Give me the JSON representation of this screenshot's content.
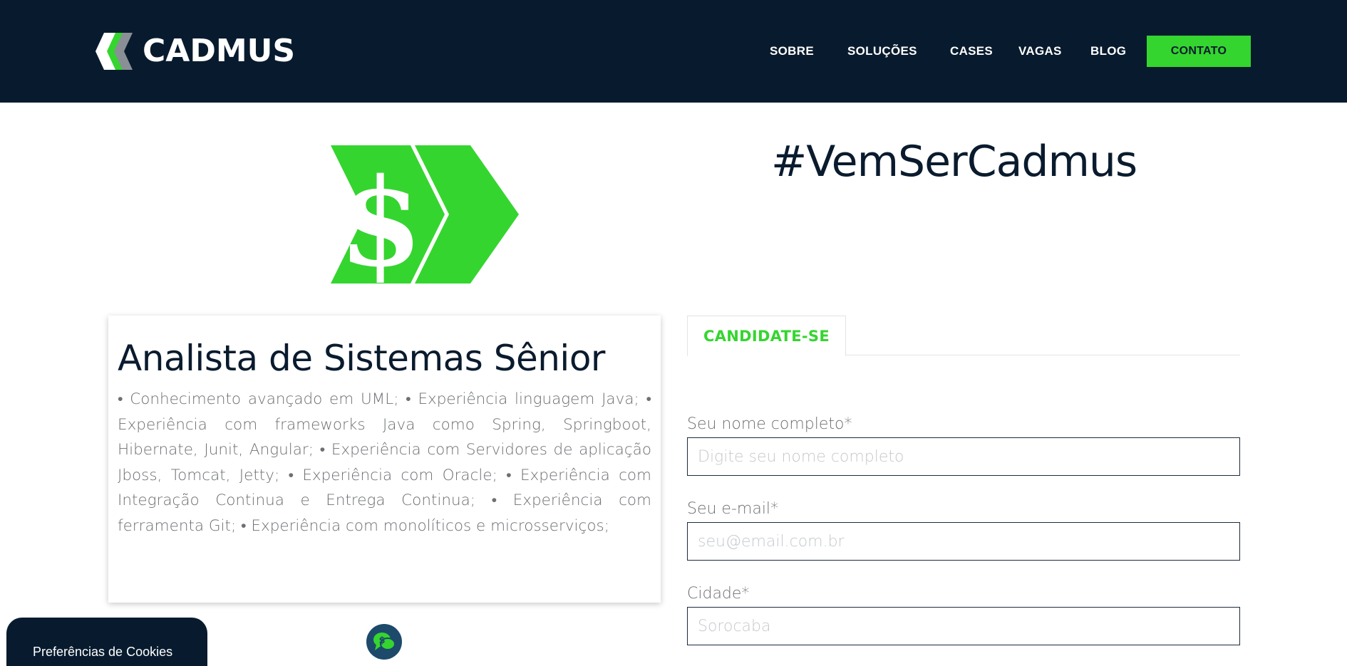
{
  "header": {
    "brand": "CADMUS",
    "nav": [
      "SOBRE",
      "SOLUÇÕES",
      "CASES",
      "VAGAS",
      "BLOG"
    ],
    "cta": "CONTATO"
  },
  "hero": {
    "icon": "dollar-chevron-icon",
    "hashtag": "#VemSerCadmus"
  },
  "job": {
    "title": "Analista de Sistemas Sênior",
    "description": "• Conhecimento avançado em UML; • Experiência linguagem Java; • Experiência com frameworks Java como Spring, Springboot, Hibernate, Junit, Angular; • Experiência com Servidores de aplicação Jboss, Tomcat, Jetty; • Experiência com Oracle; • Experiência com Integração Continua e Entrega Continua; • Experiência com ferramenta Git; • Experiência com monolíticos e microsserviços;"
  },
  "form": {
    "tab": "CANDIDATE-SE",
    "fields": [
      {
        "label": "Seu nome completo*",
        "placeholder": "Digite seu nome completo"
      },
      {
        "label": "Seu e-mail*",
        "placeholder": "seu@email.com.br"
      },
      {
        "label": "Cidade*",
        "placeholder": "Sorocaba"
      }
    ]
  },
  "cookies": {
    "label": "Preferências de Cookies"
  },
  "colors": {
    "navy": "#081b2e",
    "green": "#35d52f",
    "text_gray": "#6d6f73"
  }
}
